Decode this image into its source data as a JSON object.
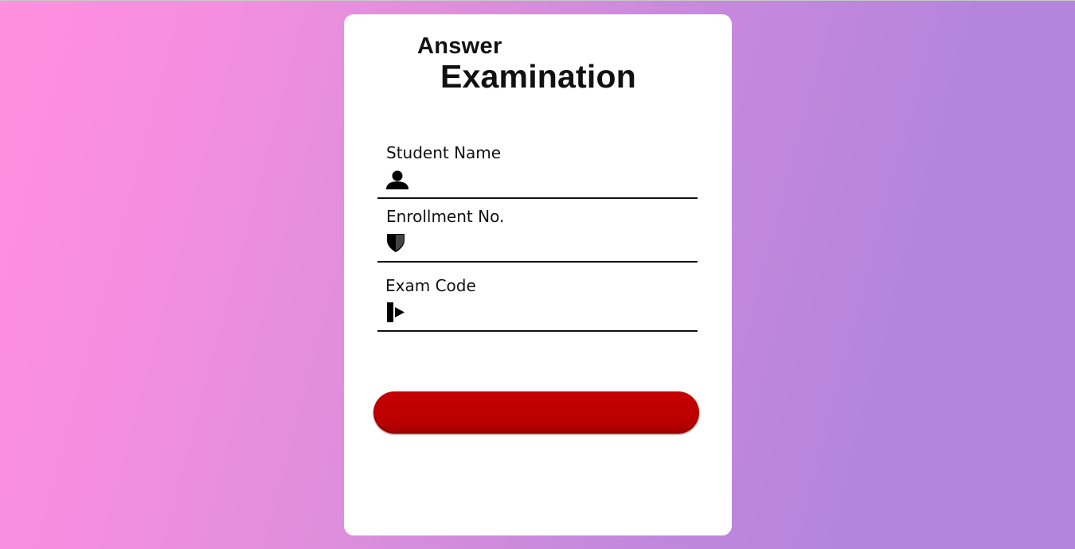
{
  "form": {
    "title_line1": "Answer",
    "title_line2": "Examination",
    "fields": [
      {
        "label": "Student Name",
        "icon": "user-icon",
        "value": ""
      },
      {
        "label": "Enrollment No.",
        "icon": "shield-icon",
        "value": ""
      },
      {
        "label": "Exam Code",
        "icon": "sign-in-icon",
        "value": ""
      }
    ],
    "submit_label": ""
  },
  "colors": {
    "background_start": "#ff8fdf",
    "background_end": "#b385dd",
    "card": "#ffffff",
    "button": "#bf0000",
    "text": "#111111"
  }
}
